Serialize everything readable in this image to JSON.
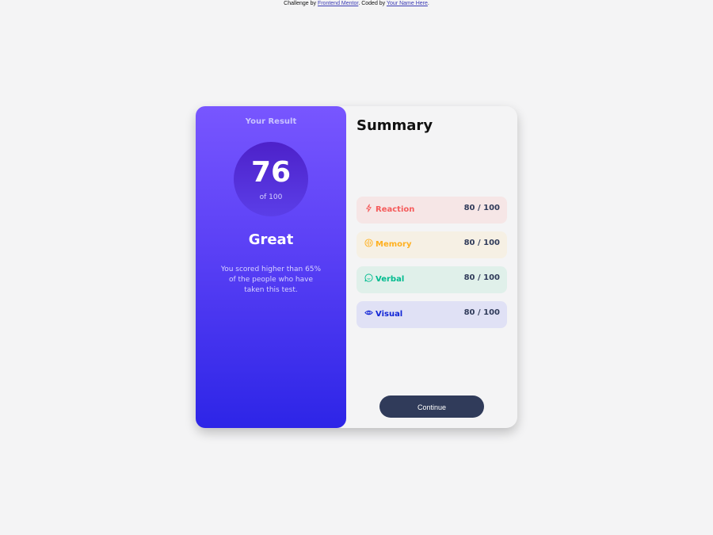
{
  "attribution": {
    "prefix": "Challenge by ",
    "challenge_link": "Frontend Mentor",
    "middle": ". Coded by ",
    "author_link": "Your Name Here",
    "suffix": "."
  },
  "result": {
    "title": "Your Result",
    "score": "76",
    "total": "of 100",
    "verdict": "Great",
    "description": "You scored higher than 65% of the people who have taken this test."
  },
  "summary": {
    "title": "Summary",
    "items": [
      {
        "label": "Reaction",
        "score": "80 / 100",
        "icon": "lightning-icon",
        "color": "#f55b5b",
        "bg": "#f6e6e6"
      },
      {
        "label": "Memory",
        "score": "80 / 100",
        "icon": "brain-icon",
        "color": "#ffb01f",
        "bg": "#f6f0e4"
      },
      {
        "label": "Verbal",
        "score": "80 / 100",
        "icon": "chat-bubble-icon",
        "color": "#00bb8f",
        "bg": "#e0f0ea"
      },
      {
        "label": "Visual",
        "score": "80 / 100",
        "icon": "eye-icon",
        "color": "#1125d6",
        "bg": "#e0e1f5"
      }
    ],
    "button_label": "Continue"
  }
}
